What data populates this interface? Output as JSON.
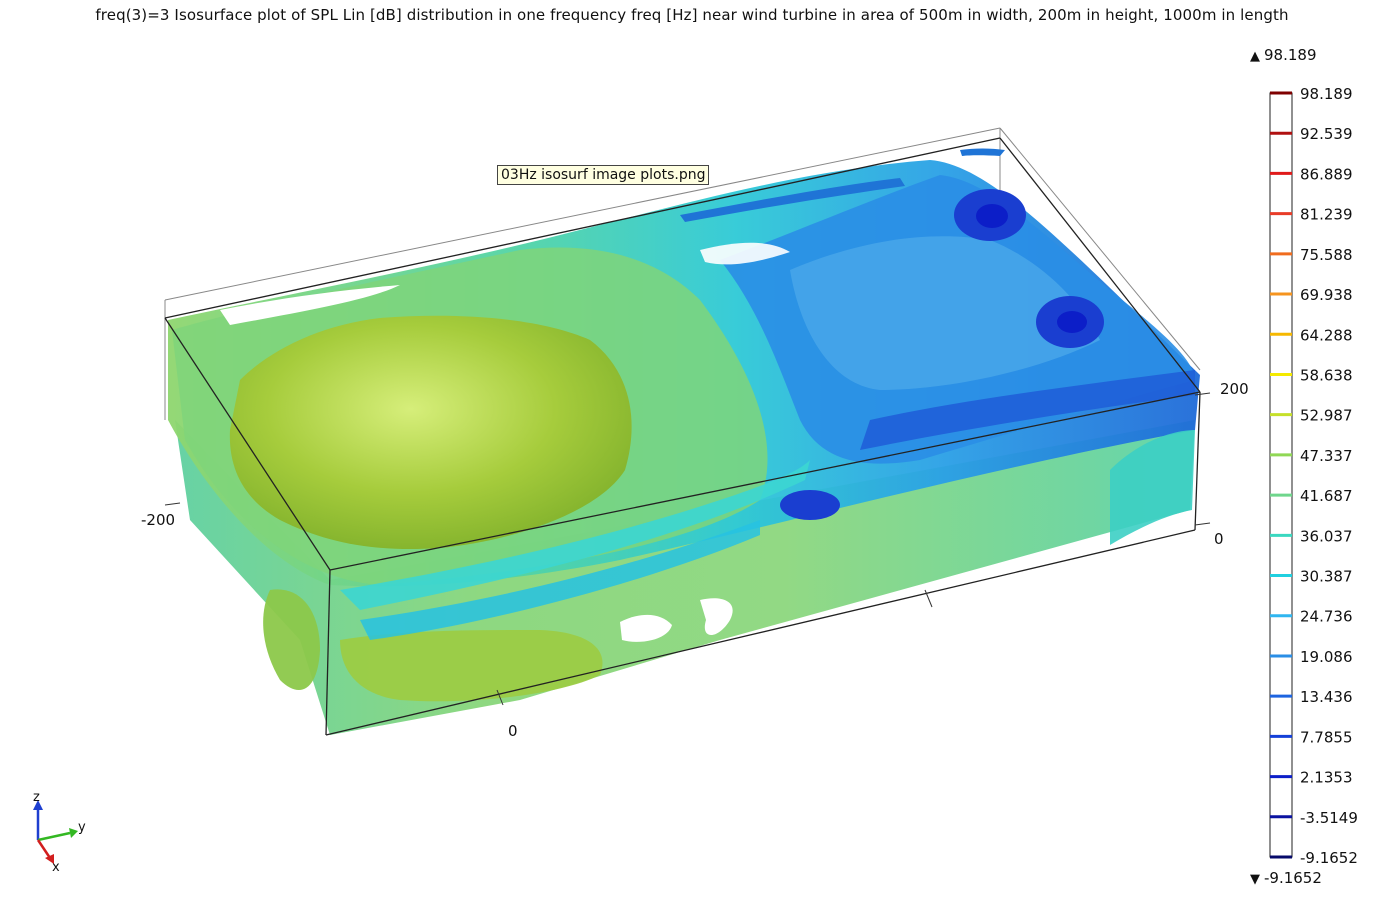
{
  "title": "freq(3)=3  Isosurface plot of SPL Lin [dB] distribution in one frequency freq [Hz] near wind turbine in area of 500m in width, 200m in height, 1000m in length",
  "tooltip": "03Hz isosurf image plots.png",
  "axes": {
    "x_tick": "0",
    "y_tick_left": "-200",
    "z_tick_top": "200",
    "z_tick_bottom": "0"
  },
  "triad": {
    "x": "x",
    "y": "y",
    "z": "z"
  },
  "colors": {
    "green_yellow": "#a6cc3c",
    "light_green": "#7fd57a",
    "aqua": "#39c7c8",
    "cyan": "#22bde6",
    "blue": "#1f74d6",
    "deep_blue": "#1a2ec8"
  },
  "chart_data": {
    "type": "heatmap",
    "quantity": "SPL Lin [dB]",
    "frequency": "freq(3)=3",
    "range_max": "98.189",
    "range_min": "-9.1652",
    "levels": [
      {
        "value": "98.189",
        "color": "#7f0000"
      },
      {
        "value": "92.539",
        "color": "#b01010"
      },
      {
        "value": "86.889",
        "color": "#e01a1a"
      },
      {
        "value": "81.239",
        "color": "#e83c28"
      },
      {
        "value": "75.588",
        "color": "#f06c1e"
      },
      {
        "value": "69.938",
        "color": "#f6941e"
      },
      {
        "value": "64.288",
        "color": "#f6b800"
      },
      {
        "value": "58.638",
        "color": "#f4ea00"
      },
      {
        "value": "52.987",
        "color": "#c6e02a"
      },
      {
        "value": "47.337",
        "color": "#90d855"
      },
      {
        "value": "41.687",
        "color": "#6fd68c"
      },
      {
        "value": "36.037",
        "color": "#3ad8c0"
      },
      {
        "value": "30.387",
        "color": "#20d0e0"
      },
      {
        "value": "24.736",
        "color": "#2fb6f0"
      },
      {
        "value": "19.086",
        "color": "#2a8ee6"
      },
      {
        "value": "13.436",
        "color": "#1d64e0"
      },
      {
        "value": "7.7855",
        "color": "#1440d8"
      },
      {
        "value": "2.1353",
        "color": "#0c1ec8"
      },
      {
        "value": "-3.5149",
        "color": "#0a12a0"
      },
      {
        "value": "-9.1652",
        "color": "#060a6a"
      }
    ]
  }
}
